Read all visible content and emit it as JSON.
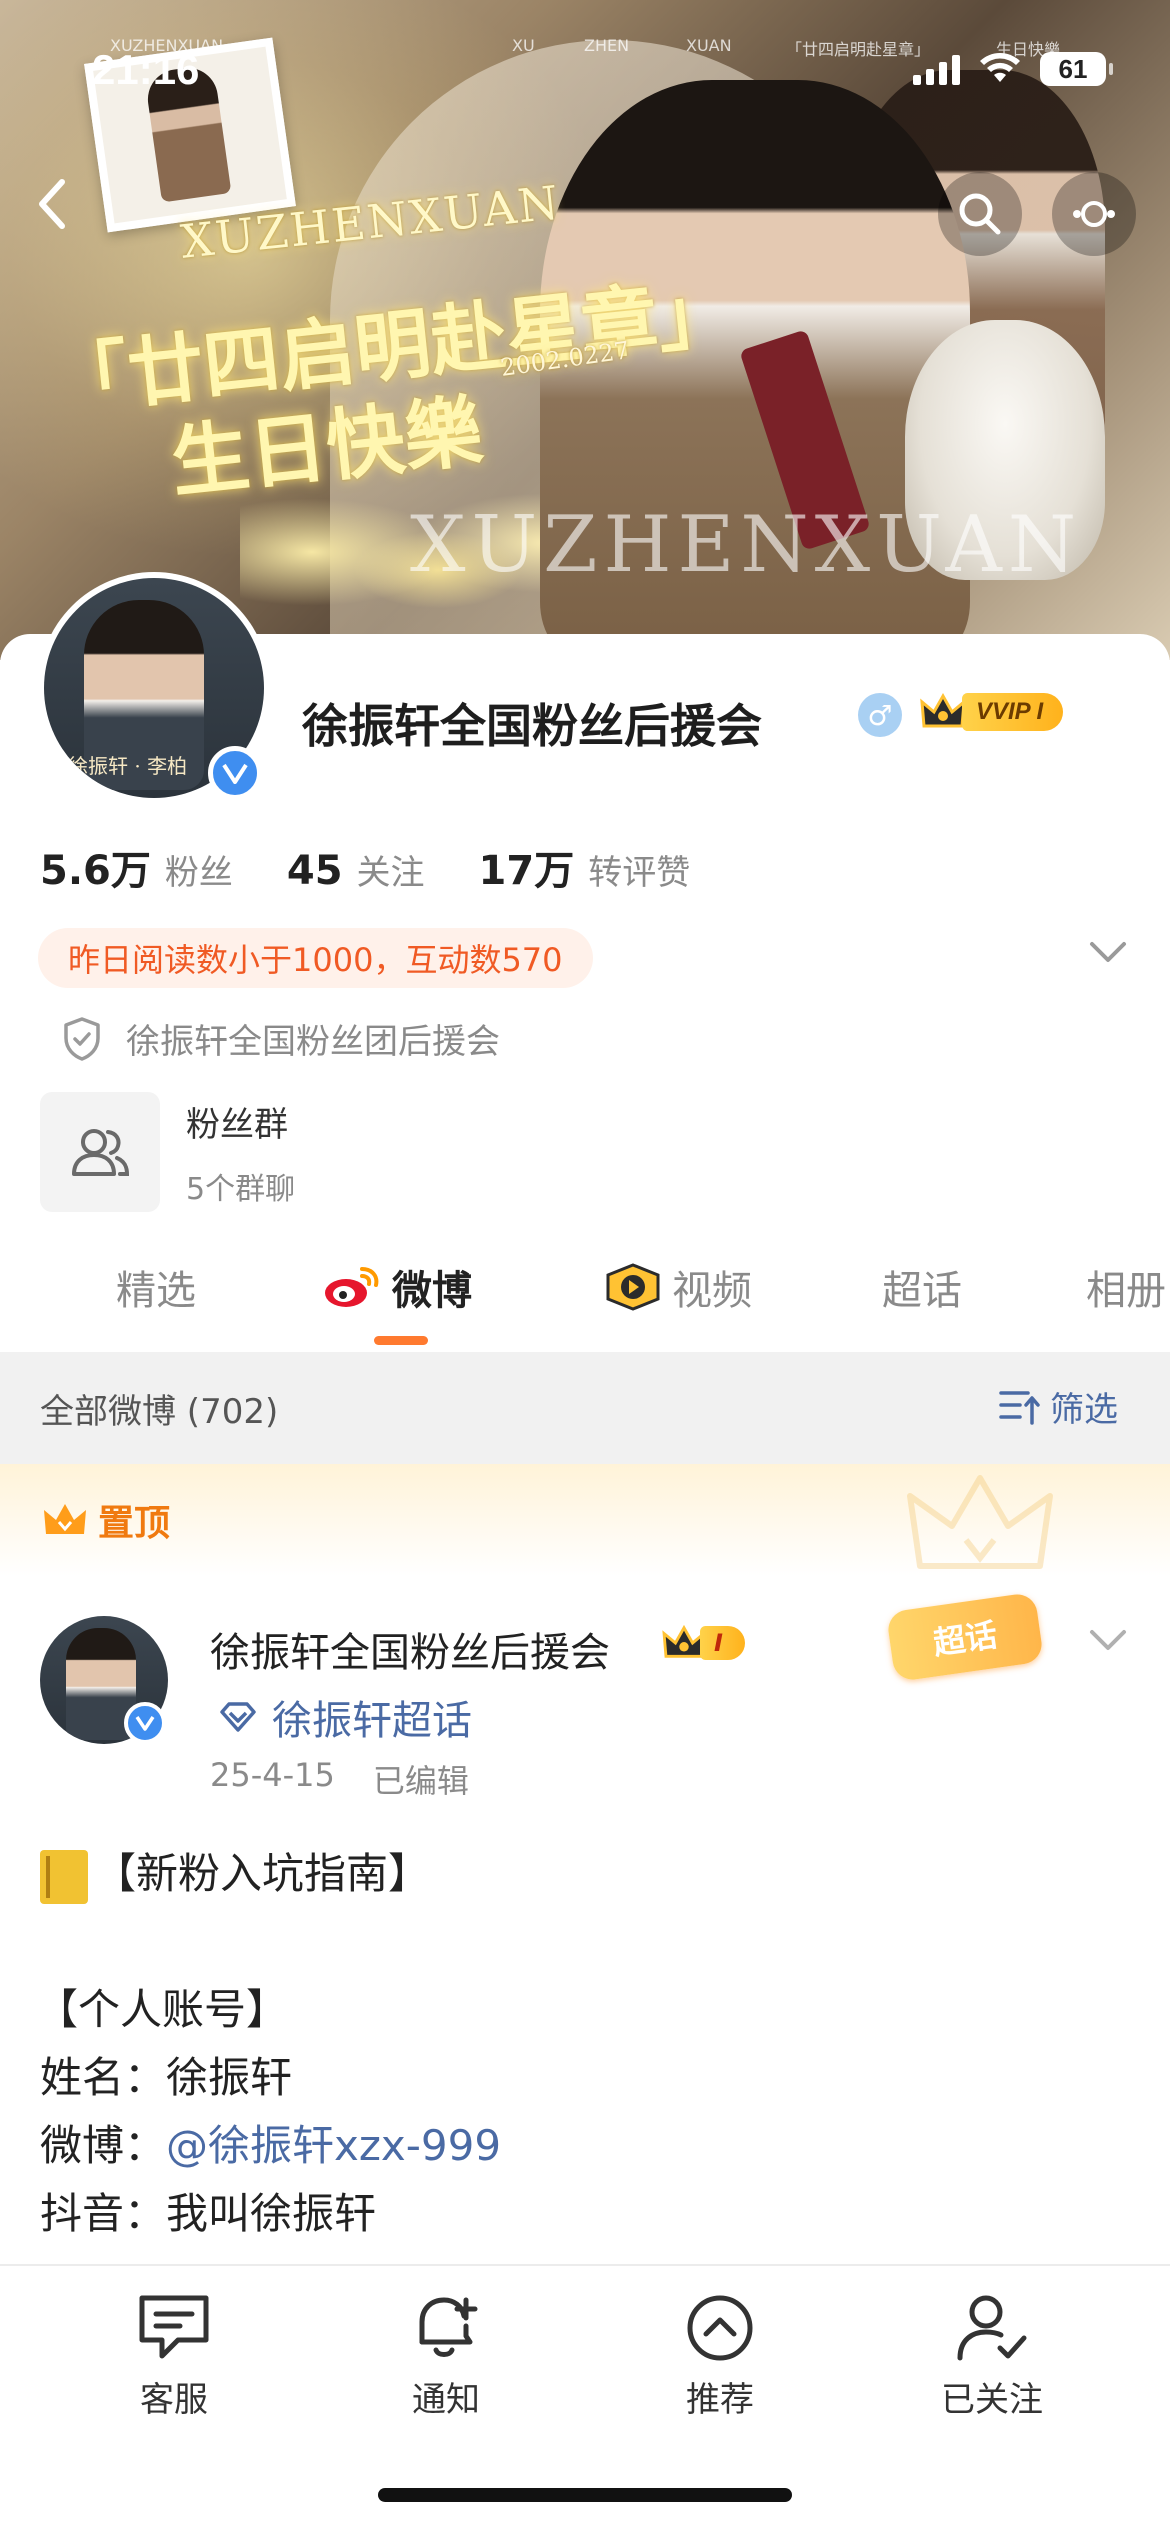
{
  "status_bar": {
    "time": "21:16",
    "battery": "61"
  },
  "banner": {
    "name_latin": "XUZHENXUAN",
    "title_line1": "「廿四启明赴星章」",
    "title_line2": "生日快樂",
    "date_tag": "2002.0227",
    "watermark": "XUZHENXUAN",
    "top_text_1": "XU",
    "top_text_2": "ZHEN",
    "top_text_3": "XUAN",
    "top_text_4": "「廿四启明赴星章」",
    "top_text_5": "生日快樂"
  },
  "profile": {
    "name": "徐振轩全国粉丝后援会",
    "vip_label": "VVIP I",
    "avatar_caption": "徐振轩 · 李柏",
    "stats": [
      {
        "value": "5.6万",
        "label": "粉丝"
      },
      {
        "value": "45",
        "label": "关注"
      },
      {
        "value": "17万",
        "label": "转评赞"
      }
    ],
    "read_info": "昨日阅读数小于1000，互动数570",
    "organization": "徐振轩全国粉丝团后援会",
    "fan_group": {
      "title": "粉丝群",
      "subtitle": "5个群聊"
    }
  },
  "tabs": [
    {
      "label": "精选"
    },
    {
      "label": "微博"
    },
    {
      "label": "视频"
    },
    {
      "label": "超话"
    },
    {
      "label": "相册"
    }
  ],
  "feed_header": {
    "all": "全部微博 (702)",
    "filter": "筛选"
  },
  "pinned": {
    "label": "置顶"
  },
  "post": {
    "author": "徐振轩全国粉丝后援会",
    "badge_label": "I",
    "sticker": "超话",
    "supertopic": "徐振轩超话",
    "date": "25-4-15",
    "edited": "已编辑",
    "lines": {
      "l1": "【新粉入坑指南】",
      "l2": "【个人账号】",
      "l3": "姓名：徐振轩",
      "l4_prefix": "微博：",
      "l4_mention": "@徐振轩xzx-999",
      "l5": "抖音：我叫徐振轩"
    }
  },
  "bottom_bar": [
    {
      "label": "客服",
      "icon": "chat-icon"
    },
    {
      "label": "通知",
      "icon": "bell-icon"
    },
    {
      "label": "推荐",
      "icon": "recommend-icon"
    },
    {
      "label": "已关注",
      "icon": "followed-user-icon"
    }
  ],
  "colors": {
    "accent": "#ff7a2f",
    "link": "#4a6aa4",
    "verified": "#3f8ef0",
    "vip_gold": "#ffc233"
  }
}
